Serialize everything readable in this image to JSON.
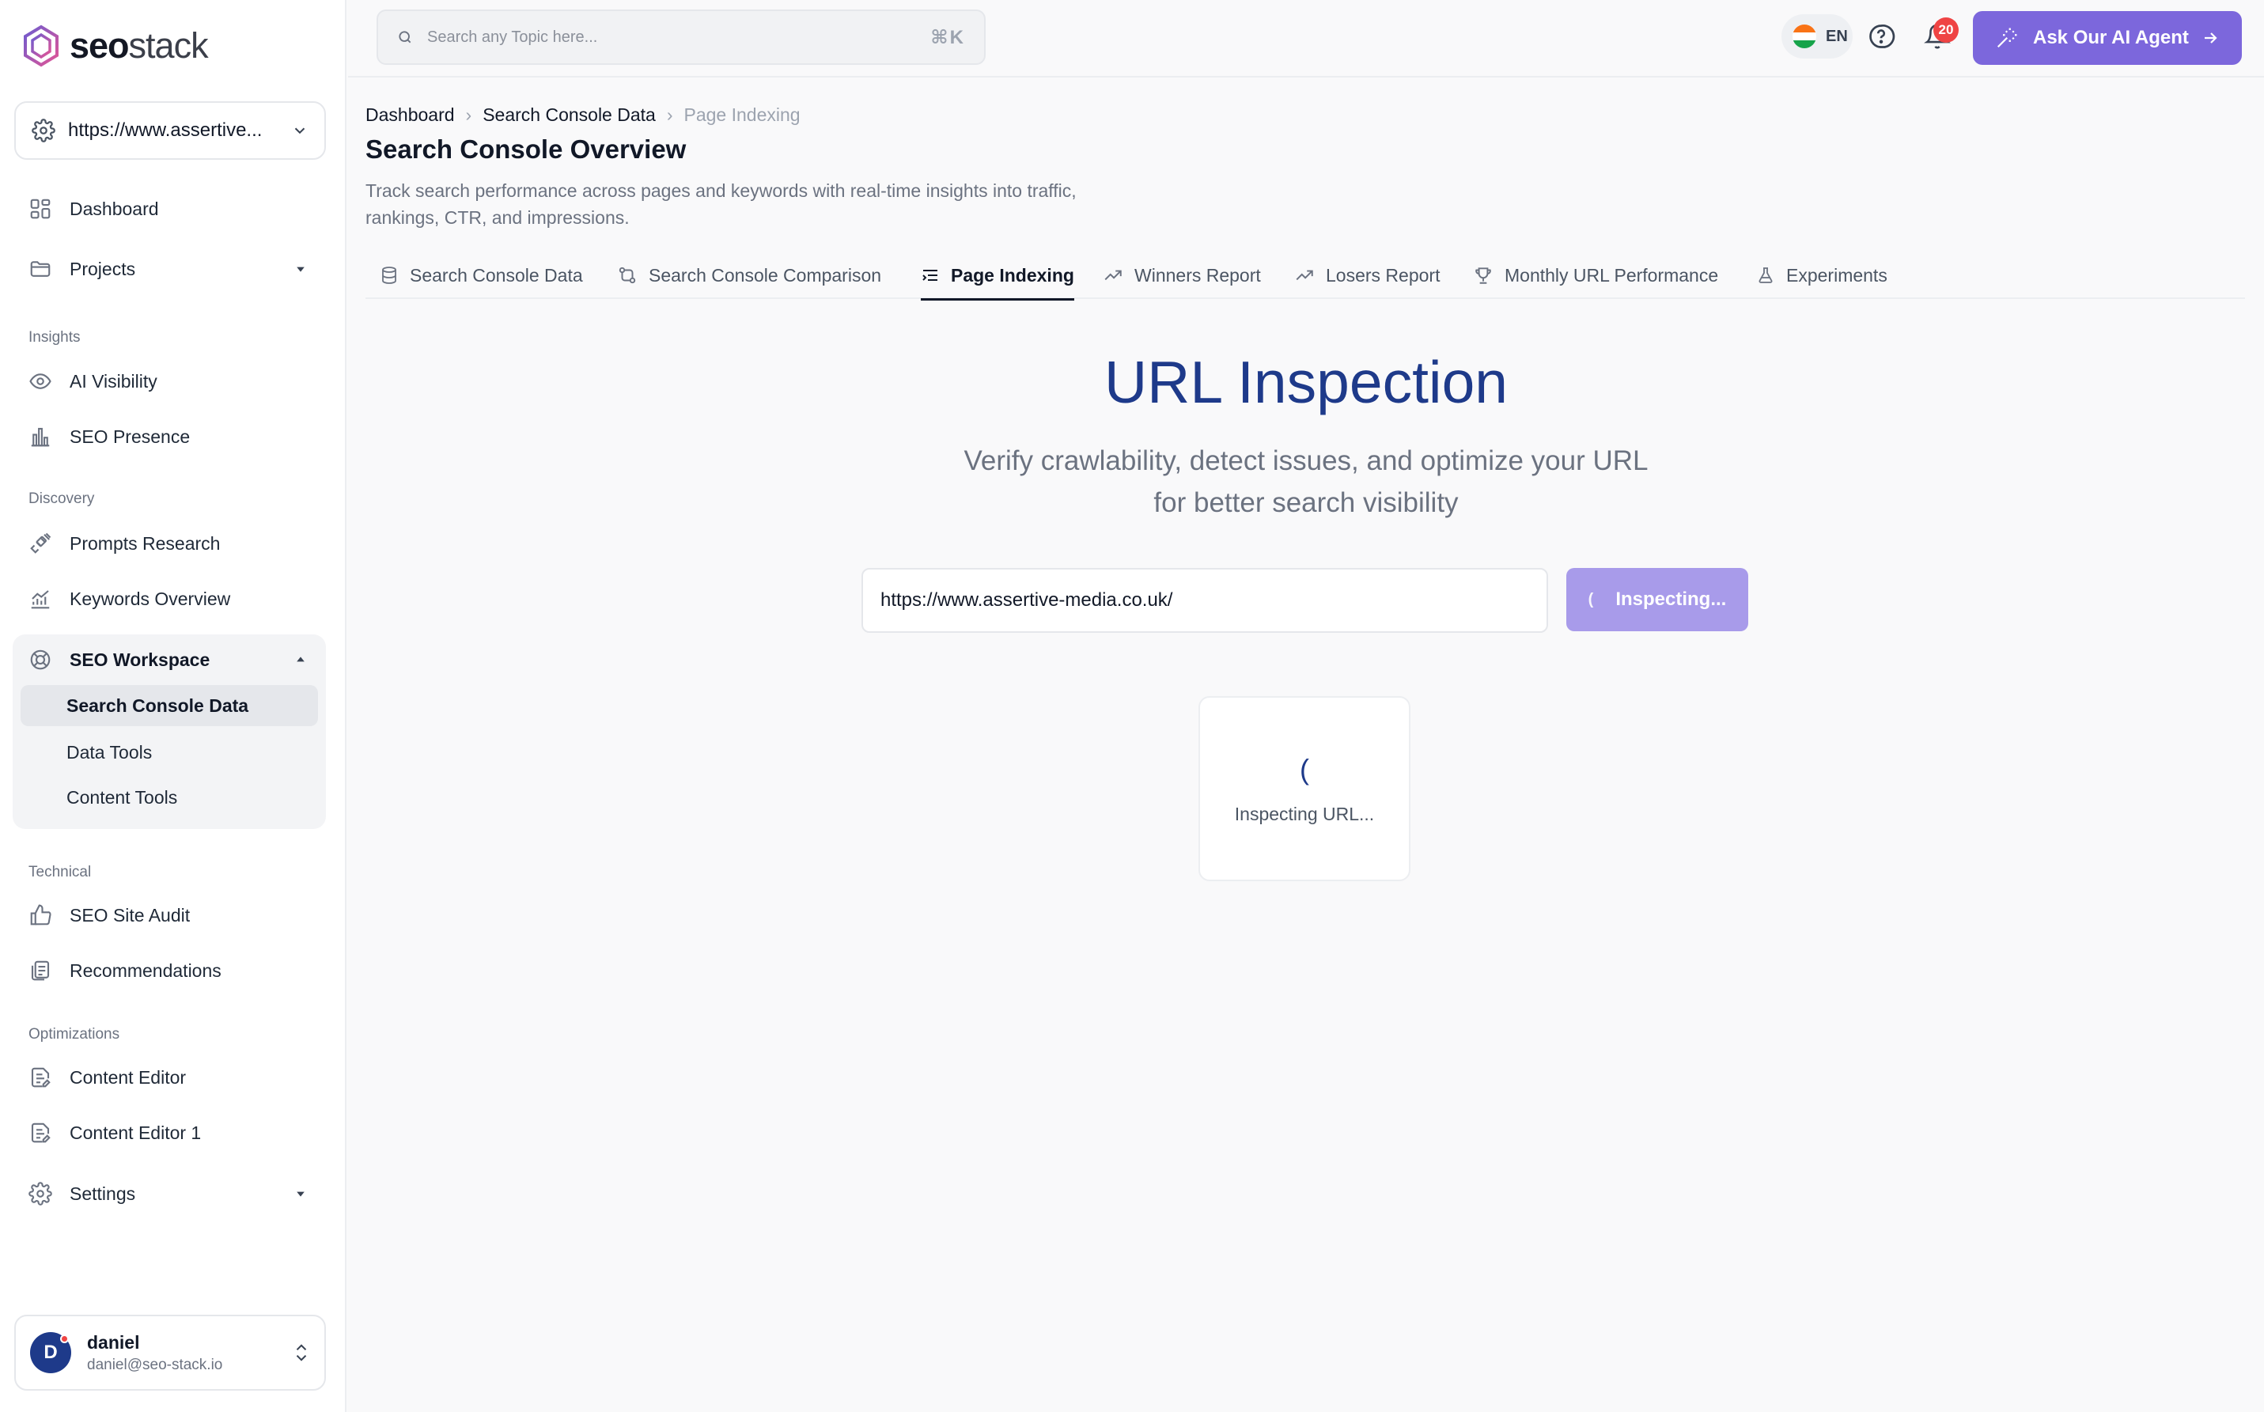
{
  "brand": {
    "name_bold": "seo",
    "name_light": "stack"
  },
  "site_selector": {
    "url": "https://www.assertive..."
  },
  "sidebar": {
    "dashboard": "Dashboard",
    "projects": "Projects",
    "sections": {
      "insights": "Insights",
      "discovery": "Discovery",
      "technical": "Technical",
      "optimizations": "Optimizations"
    },
    "ai_visibility": "AI Visibility",
    "seo_presence": "SEO Presence",
    "prompts_research": "Prompts Research",
    "keywords_overview": "Keywords Overview",
    "seo_workspace": "SEO Workspace",
    "workspace_items": [
      "Search Console Data",
      "Data Tools",
      "Content Tools"
    ],
    "seo_site_audit": "SEO Site Audit",
    "recommendations": "Recommendations",
    "content_editor": "Content Editor",
    "content_editor_1": "Content Editor 1",
    "settings": "Settings"
  },
  "user": {
    "initial": "D",
    "name": "daniel",
    "email": "daniel@seo-stack.io"
  },
  "topbar": {
    "search_placeholder": "Search any Topic here...",
    "shortcut": "⌘K",
    "language": "EN",
    "notification_count": "20",
    "ai_button": "Ask Our AI Agent"
  },
  "breadcrumb": [
    "Dashboard",
    "Search Console Data",
    "Page Indexing"
  ],
  "page": {
    "title": "Search Console Overview",
    "description": "Track search performance across pages and keywords with real-time insights into traffic, rankings, CTR, and impressions."
  },
  "tabs": [
    "Search Console Data",
    "Search Console Comparison",
    "Page Indexing",
    "Winners Report",
    "Losers Report",
    "Monthly URL Performance",
    "Experiments"
  ],
  "active_tab": "Page Indexing",
  "inspection": {
    "title": "URL Inspection",
    "subtitle": "Verify crawlability, detect issues, and optimize your URL for better search visibility",
    "url_value": "https://www.assertive-media.co.uk/",
    "button_label": "Inspecting...",
    "loading_text": "Inspecting URL..."
  },
  "colors": {
    "accent": "#7c67dc",
    "accent_disabled": "#a89bea",
    "heading_blue": "#1e3a8a",
    "badge_red": "#ef4444"
  }
}
